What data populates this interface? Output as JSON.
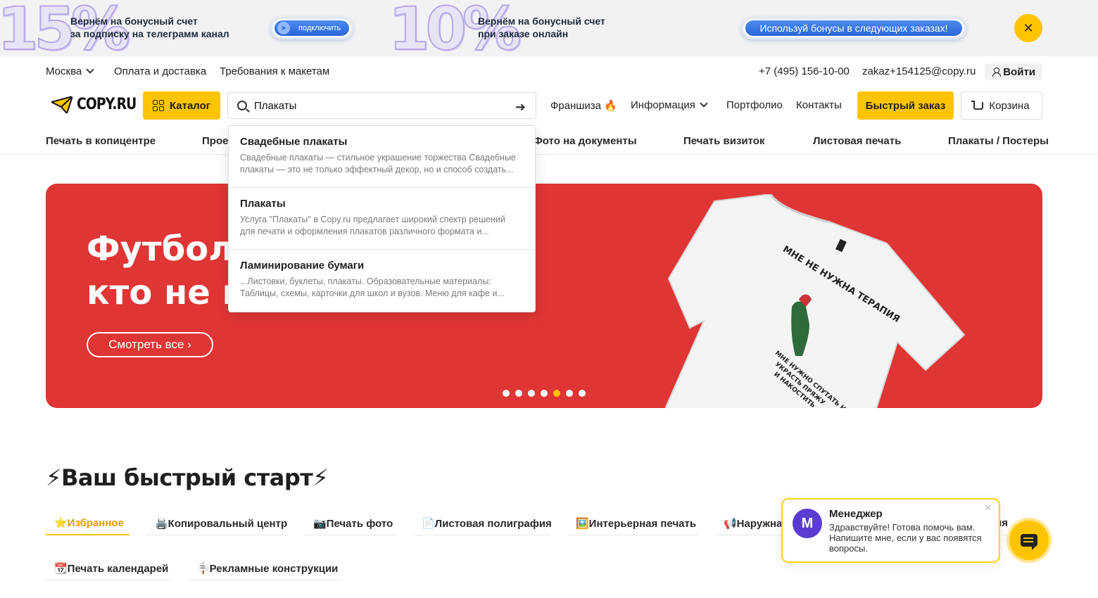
{
  "promo": {
    "big_15": "15%",
    "text_1_line1": "Вернём на бонусный счет",
    "text_1_line2": "за подписку на телеграмм канал",
    "telegram_button": "подключить",
    "big_10": "10%",
    "text_2_line1": "Вернём на бонусный счет",
    "text_2_line2": "при заказе онлайн",
    "bonus_button": "Используй бонусы в следующих заказах!",
    "close_icon": "close-icon"
  },
  "topbar": {
    "city": "Москва",
    "delivery": "Оплата и доставка",
    "requirements": "Требования к макетам",
    "phone": "+7 (495) 156-10-00",
    "email": "zakaz+154125@copy.ru",
    "login": "Войти"
  },
  "header": {
    "logo_text": "COPY.RU",
    "catalog": "Каталог",
    "search_value": "Плакаты",
    "franchise": "Франшиза 🔥",
    "info": "Информация",
    "portfolio": "Портфолио",
    "contacts": "Контакты",
    "fast_order": "Быстрый заказ",
    "cart": "Корзина"
  },
  "services": [
    "Печать в копицентре",
    "Прое",
    "Фото на документы",
    "Печать визиток",
    "Листовая печать",
    "Плакаты / Постеры"
  ],
  "search_results": [
    {
      "title": "Свадебные плакаты",
      "desc_line1": "Свадебные плакаты — стильное украшение торжества Свадебные",
      "desc_line2": "плакаты — это не только эффектный декор, но и способ создать..."
    },
    {
      "title": "Плакаты",
      "desc_line1": "Услуга \"Плакаты\" в Copy.ru предлагает широкий спектр решений",
      "desc_line2": "для печати и оформления плакатов различного формата и..."
    },
    {
      "title": "Ламинирование бумаги",
      "desc_line1": "...Листовки, буклеты, плакаты. Образовательные материалы:",
      "desc_line2": "Таблицы, схемы, карточки для школ и вузов. Меню для кафе и..."
    }
  ],
  "hero": {
    "title_line1": "Футболк",
    "title_line2": "кто не в",
    "button": "Смотреть все  ›",
    "active_slide": 5,
    "slide_count": 7,
    "accent_color": "#e03535"
  },
  "quick_start": {
    "title": "⚡Ваш быстрый старт⚡",
    "tabs": [
      "⭐Избранное",
      "🖨️Копировальный центр",
      "📷Печать фото",
      "📄Листовая полиграфия",
      "🖼️Интерьерная печать",
      "📢Наружна",
      "ия",
      "📆Печать календарей",
      "🪧Рекламные конструкции"
    ]
  },
  "chat": {
    "name": "Менеджер",
    "message": "Здравствуйте! Готова помочь вам. Напишите мне, если у вас появятся вопросы.",
    "avatar_letter": "М"
  },
  "colors": {
    "brand_yellow": "#ffc400",
    "hero_red": "#e03535"
  }
}
